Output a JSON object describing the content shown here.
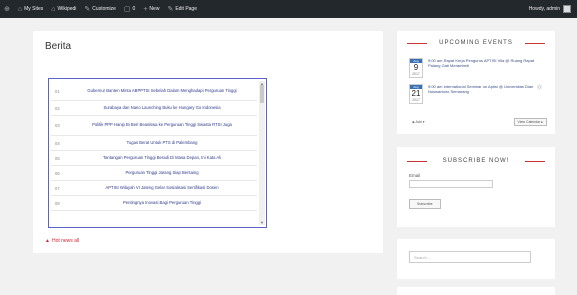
{
  "adminbar": {
    "items": [
      {
        "icon": "wordpress-icon",
        "glyph": "⊕",
        "label": ""
      },
      {
        "icon": "my-sites-icon",
        "glyph": "⌂",
        "label": "My Sites"
      },
      {
        "icon": "site-icon",
        "glyph": "⌂",
        "label": "Wikipedi"
      },
      {
        "icon": "customize-icon",
        "glyph": "✎",
        "label": "Customize"
      },
      {
        "icon": "comments-icon",
        "glyph": "▢",
        "label": "0"
      },
      {
        "icon": "new-icon",
        "glyph": "+",
        "label": "New"
      },
      {
        "icon": "edit-page-icon",
        "glyph": "✎",
        "label": "Edit Page"
      }
    ],
    "user_label": "Howdy, admin"
  },
  "page": {
    "title": "Berita",
    "rows": [
      {
        "num": "01",
        "title": "Gubernur Banten Minta ABPPTSI Sebelah Dalam Menghadapi Perguruan Tinggi"
      },
      {
        "num": "02",
        "title": "Surabaya dan Nano Launching Buku ke Hungary Go Indonesia"
      },
      {
        "num": "03",
        "title": "Politik PPP Hanip Bi Beri Beasiswa ke Perguruan Tinggi Swasta RTSI Juga"
      },
      {
        "num": "04",
        "title": "Tugas Berat Untuk PTS di Palembang"
      },
      {
        "num": "05",
        "title": "Tantangan Perguruan Tinggi Beradi Di Masa Depan, Ini Kata Ali"
      },
      {
        "num": "06",
        "title": "Perguruan Tinggi Jarang Siap Bersaing"
      },
      {
        "num": "07",
        "title": "APTISI Wilayah VI Jateng Gelar Sosialisasi Sertifikasi Dosen"
      },
      {
        "num": "08",
        "title": "Pentingnya Inovasi Bagi Perguruan Tinggi"
      }
    ],
    "hot_link": "Hot news all"
  },
  "events_widget": {
    "title": "UPCOMING EVENTS",
    "events": [
      {
        "month": "Aug",
        "day": "9",
        "year": "2017",
        "title": "9:00 am Rapat Kerja Pengurus APTISI Vila @ Ruang Rapat Palang Gati Merambeti"
      },
      {
        "month": "Aug",
        "day": "21",
        "year": "2017",
        "title": "9:00 am International Seminar on Aptisi @ Universitas Dian Nuswantoro Semarang"
      }
    ],
    "add_button": "Add",
    "calendar_button": "View Calendar"
  },
  "subscribe_widget": {
    "title": "SUBSCRIBE NOW!",
    "email_label": "Email",
    "email_value": "",
    "subscribe_button": "Subscribe"
  },
  "search_widget": {
    "placeholder": "Search ..."
  },
  "colors": {
    "admin_bar": "#23282d",
    "accent_red": "#cc3333",
    "link_blue": "#2d3a8c",
    "frame_blue": "#5a63c7"
  }
}
